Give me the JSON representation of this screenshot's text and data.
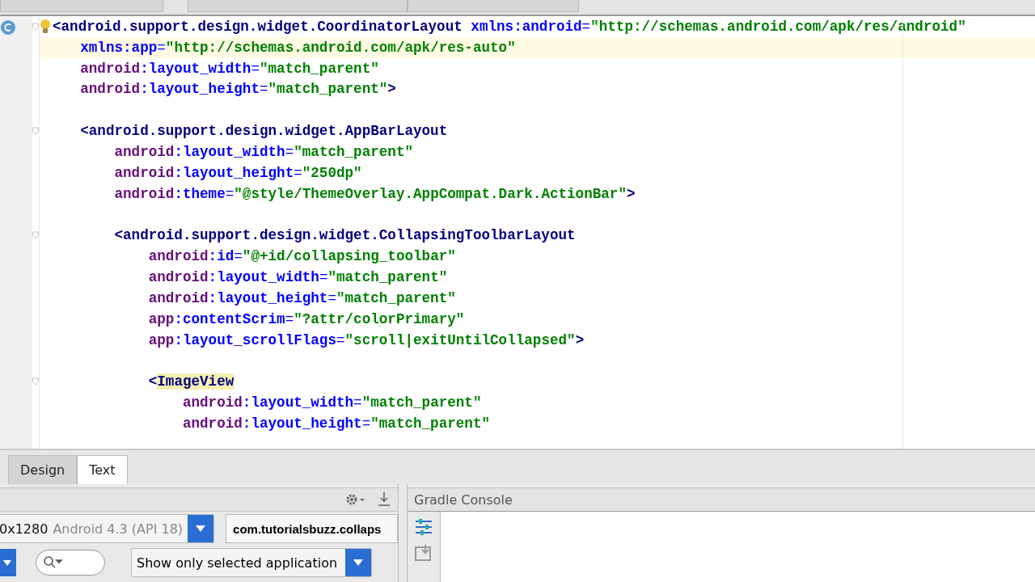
{
  "editor": {
    "lines": [
      {
        "kind": "code",
        "current": false,
        "fold": true,
        "tokens": [
          {
            "kind": "tag",
            "text": "<android.support.design.widget.CoordinatorLayout"
          },
          {
            "kind": "attr",
            "text": " xmlns:android"
          },
          {
            "kind": "punct",
            "text": "="
          },
          {
            "kind": "value",
            "text": "\"http://schemas.android.com/apk/res/android\""
          }
        ]
      },
      {
        "kind": "code",
        "current": true,
        "fold": false,
        "tokens": [
          {
            "kind": "attr",
            "text": "    xmlns:app"
          },
          {
            "kind": "punct",
            "text": "="
          },
          {
            "kind": "value",
            "text": "\"http://schemas.android.com/apk/res-auto\""
          }
        ]
      },
      {
        "kind": "code",
        "current": false,
        "fold": false,
        "tokens": [
          {
            "kind": "ns",
            "text": "    android"
          },
          {
            "kind": "attr",
            "text": ":layout_width"
          },
          {
            "kind": "punct",
            "text": "="
          },
          {
            "kind": "value",
            "text": "\"match_parent\""
          }
        ]
      },
      {
        "kind": "code",
        "current": false,
        "fold": false,
        "tokens": [
          {
            "kind": "ns",
            "text": "    android"
          },
          {
            "kind": "attr",
            "text": ":layout_height"
          },
          {
            "kind": "punct",
            "text": "="
          },
          {
            "kind": "value",
            "text": "\"match_parent\""
          },
          {
            "kind": "tag",
            "text": ">"
          }
        ]
      },
      {
        "kind": "blank",
        "current": false,
        "fold": false
      },
      {
        "kind": "code",
        "current": false,
        "fold": true,
        "tokens": [
          {
            "kind": "tag",
            "text": "    <android.support.design.widget.AppBarLayout"
          }
        ]
      },
      {
        "kind": "code",
        "current": false,
        "fold": false,
        "tokens": [
          {
            "kind": "ns",
            "text": "        android"
          },
          {
            "kind": "attr",
            "text": ":layout_width"
          },
          {
            "kind": "punct",
            "text": "="
          },
          {
            "kind": "value",
            "text": "\"match_parent\""
          }
        ]
      },
      {
        "kind": "code",
        "current": false,
        "fold": false,
        "tokens": [
          {
            "kind": "ns",
            "text": "        android"
          },
          {
            "kind": "attr",
            "text": ":layout_height"
          },
          {
            "kind": "punct",
            "text": "="
          },
          {
            "kind": "value",
            "text": "\"250dp\""
          }
        ]
      },
      {
        "kind": "code",
        "current": false,
        "fold": false,
        "tokens": [
          {
            "kind": "ns",
            "text": "        android"
          },
          {
            "kind": "attr",
            "text": ":theme"
          },
          {
            "kind": "punct",
            "text": "="
          },
          {
            "kind": "value",
            "text": "\"@style/ThemeOverlay.AppCompat.Dark.ActionBar\""
          },
          {
            "kind": "tag",
            "text": ">"
          }
        ]
      },
      {
        "kind": "blank",
        "current": false,
        "fold": false
      },
      {
        "kind": "code",
        "current": false,
        "fold": true,
        "tokens": [
          {
            "kind": "tag",
            "text": "        <android.support.design.widget.CollapsingToolbarLayout"
          }
        ]
      },
      {
        "kind": "code",
        "current": false,
        "fold": false,
        "tokens": [
          {
            "kind": "ns",
            "text": "            android"
          },
          {
            "kind": "attr",
            "text": ":id"
          },
          {
            "kind": "punct",
            "text": "="
          },
          {
            "kind": "value",
            "text": "\"@+id/collapsing_toolbar\""
          }
        ]
      },
      {
        "kind": "code",
        "current": false,
        "fold": false,
        "tokens": [
          {
            "kind": "ns",
            "text": "            android"
          },
          {
            "kind": "attr",
            "text": ":layout_width"
          },
          {
            "kind": "punct",
            "text": "="
          },
          {
            "kind": "value",
            "text": "\"match_parent\""
          }
        ]
      },
      {
        "kind": "code",
        "current": false,
        "fold": false,
        "tokens": [
          {
            "kind": "ns",
            "text": "            android"
          },
          {
            "kind": "attr",
            "text": ":layout_height"
          },
          {
            "kind": "punct",
            "text": "="
          },
          {
            "kind": "value",
            "text": "\"match_parent\""
          }
        ]
      },
      {
        "kind": "code",
        "current": false,
        "fold": false,
        "tokens": [
          {
            "kind": "ns",
            "text": "            app"
          },
          {
            "kind": "attr",
            "text": ":contentScrim"
          },
          {
            "kind": "punct",
            "text": "="
          },
          {
            "kind": "value",
            "text": "\"?attr/colorPrimary\""
          }
        ]
      },
      {
        "kind": "code",
        "current": false,
        "fold": false,
        "tokens": [
          {
            "kind": "ns",
            "text": "            app"
          },
          {
            "kind": "attr",
            "text": ":layout_scrollFlags"
          },
          {
            "kind": "punct",
            "text": "="
          },
          {
            "kind": "value",
            "text": "\"scroll|exitUntilCollapsed\""
          },
          {
            "kind": "tag",
            "text": ">"
          }
        ]
      },
      {
        "kind": "blank",
        "current": false,
        "fold": false
      },
      {
        "kind": "code",
        "current": false,
        "fold": true,
        "tokens": [
          {
            "kind": "tag",
            "text": "            <"
          },
          {
            "kind": "tag-match",
            "text": "ImageView"
          }
        ]
      },
      {
        "kind": "code",
        "current": false,
        "fold": false,
        "tokens": [
          {
            "kind": "ns",
            "text": "                android"
          },
          {
            "kind": "attr",
            "text": ":layout_width"
          },
          {
            "kind": "punct",
            "text": "="
          },
          {
            "kind": "value",
            "text": "\"match_parent\""
          }
        ]
      },
      {
        "kind": "code",
        "current": false,
        "fold": false,
        "tokens": [
          {
            "kind": "ns",
            "text": "                android"
          },
          {
            "kind": "attr",
            "text": ":layout_height"
          },
          {
            "kind": "punct",
            "text": "="
          },
          {
            "kind": "value",
            "text": "\"match_parent\""
          }
        ]
      }
    ]
  },
  "view_tabs": [
    {
      "label": "Design",
      "selected": false
    },
    {
      "label": "Text",
      "selected": true
    }
  ],
  "monitor": {
    "device_size": "0x1280",
    "device_name": "Android 4.3 (API 18)",
    "package": "com.tutorialsbuzz.collaps",
    "filter": "Show only selected application"
  },
  "gradle": {
    "title": "Gradle Console"
  }
}
